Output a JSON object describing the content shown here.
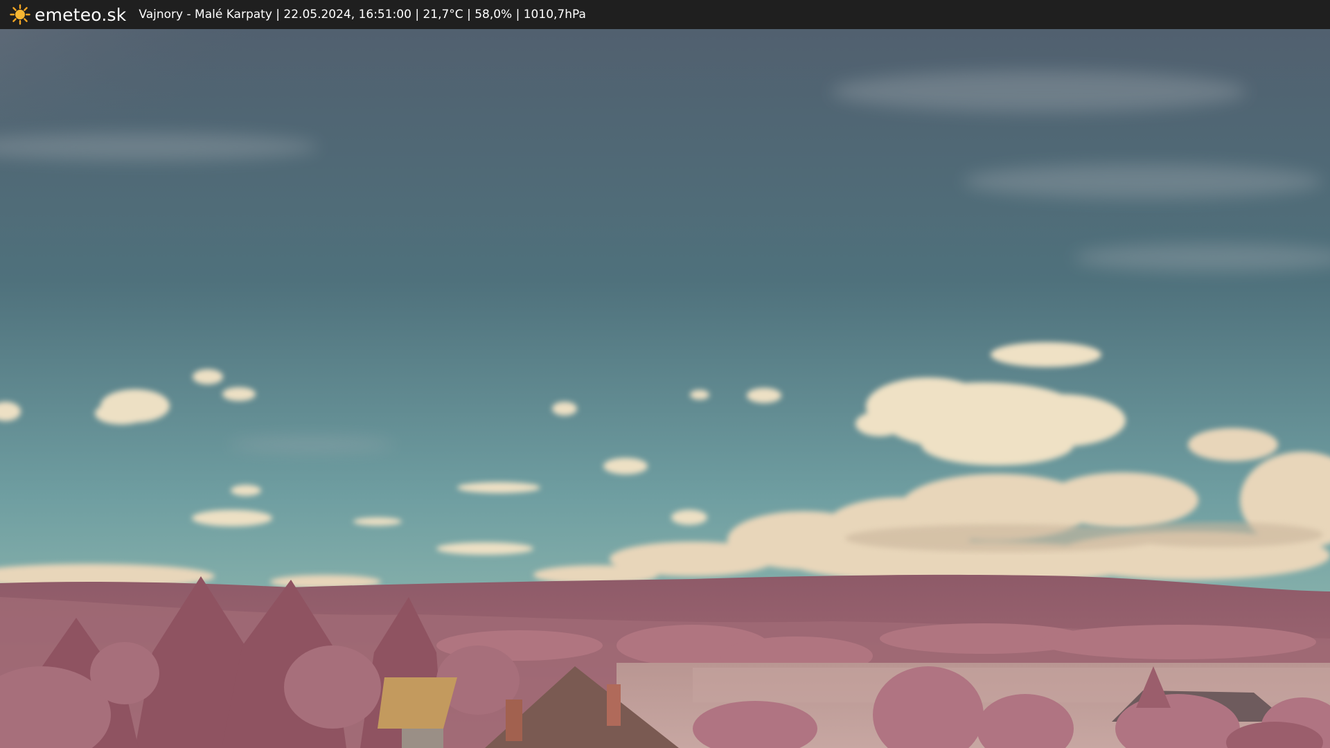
{
  "header": {
    "brand": "emeteo.sk",
    "info": "Vajnory - Malé Karpaty | 22.05.2024, 16:51:00 | 21,7°C | 58,0% | 1010,7hPa",
    "logo_icon": "sun-icon"
  },
  "colors": {
    "bar": "#1f1f1f",
    "sun": "#f5a623",
    "sky_top": "#4e6475",
    "sky_horizon": "#86b2ad",
    "cloud": "#efe1c6",
    "hills": "#9b6470",
    "foliage": "#a86a78",
    "field": "#c1a09c"
  }
}
